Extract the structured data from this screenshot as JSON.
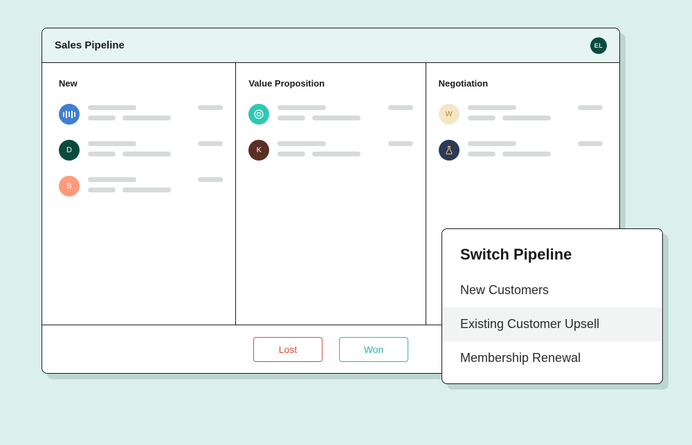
{
  "window": {
    "title": "Sales Pipeline",
    "user_initials": "EL"
  },
  "columns": [
    {
      "title": "New",
      "cards": [
        {
          "avatar": {
            "type": "icon",
            "name": "audio-bars-icon",
            "color": "blue"
          }
        },
        {
          "avatar": {
            "type": "letter",
            "letter": "D",
            "color": "dgreen"
          }
        },
        {
          "avatar": {
            "type": "letter",
            "letter": "B",
            "color": "coral"
          }
        }
      ]
    },
    {
      "title": "Value Proposition",
      "cards": [
        {
          "avatar": {
            "type": "icon",
            "name": "target-icon",
            "color": "teal"
          }
        },
        {
          "avatar": {
            "type": "letter",
            "letter": "K",
            "color": "brown"
          }
        }
      ]
    },
    {
      "title": "Negotiation",
      "cards": [
        {
          "avatar": {
            "type": "letter",
            "letter": "W",
            "color": "cream"
          }
        },
        {
          "avatar": {
            "type": "icon",
            "name": "flask-icon",
            "color": "navy"
          }
        }
      ]
    }
  ],
  "footer": {
    "lost_label": "Lost",
    "won_label": "Won"
  },
  "popover": {
    "title": "Switch Pipeline",
    "items": [
      {
        "label": "New Customers",
        "hover": false
      },
      {
        "label": "Existing Customer Upsell",
        "hover": true
      },
      {
        "label": "Membership Renewal",
        "hover": false
      }
    ]
  },
  "colors": {
    "accent_teal": "#2fb5a6",
    "accent_red": "#d94a3f",
    "bg": "#dbf0ed"
  }
}
